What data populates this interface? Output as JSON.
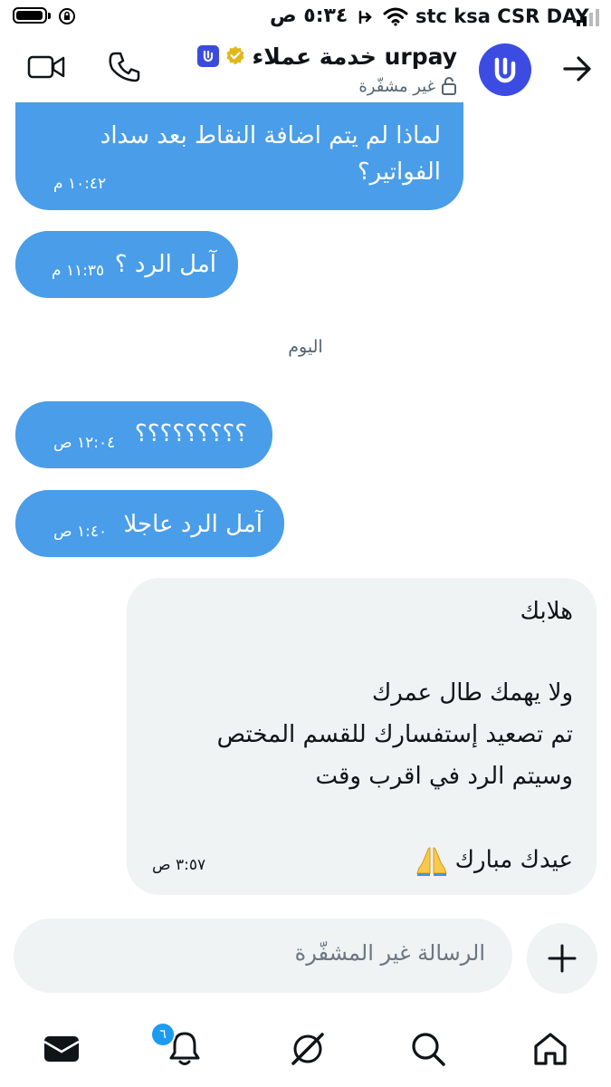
{
  "status_bar": {
    "time": "٥:٣٤ ص",
    "carrier": "stc ksa CSR DAY"
  },
  "header": {
    "title": "خدمة عملاء urpay",
    "subtitle": "غير مشفّرة",
    "icons": [
      "video-icon",
      "phone-icon",
      "back-arrow-icon",
      "verified-badge-icon",
      "open-lock-icon"
    ]
  },
  "messages": [
    {
      "text": "لماذا لم يتم اضافة النقاط بعد سداد الفواتير؟",
      "time": "١٠:٤٢ م"
    },
    {
      "text": "آمل الرد ؟",
      "time": "١١:٣٥ م"
    },
    {
      "text": "؟؟؟؟؟؟؟؟؟",
      "time": "١٢:٠٤ ص"
    },
    {
      "text": "آمل الرد عاجلا",
      "time": "١:٤٠ ص"
    }
  ],
  "day_separator": "اليوم",
  "reply": {
    "lines": [
      "هلابك",
      "ولا يهمك طال عمرك",
      "تم تصعيد إستفسارك للقسم المختص",
      "وسيتم الرد في اقرب وقت",
      "عيدك مبارك"
    ],
    "emoji": "🙏",
    "time": "٣:٥٧ ص"
  },
  "composer": {
    "placeholder": "الرسالة غير المشفّرة"
  },
  "bottom_nav": {
    "notification_count": "٦",
    "items": [
      "mail-icon",
      "bell-icon",
      "grok-icon",
      "search-icon",
      "home-icon"
    ]
  },
  "colors": {
    "bubble_sent": "#4a9de8",
    "bubble_received": "#eff3f4",
    "brand": "#3c4ce3",
    "badge": "#1d9bf0"
  }
}
